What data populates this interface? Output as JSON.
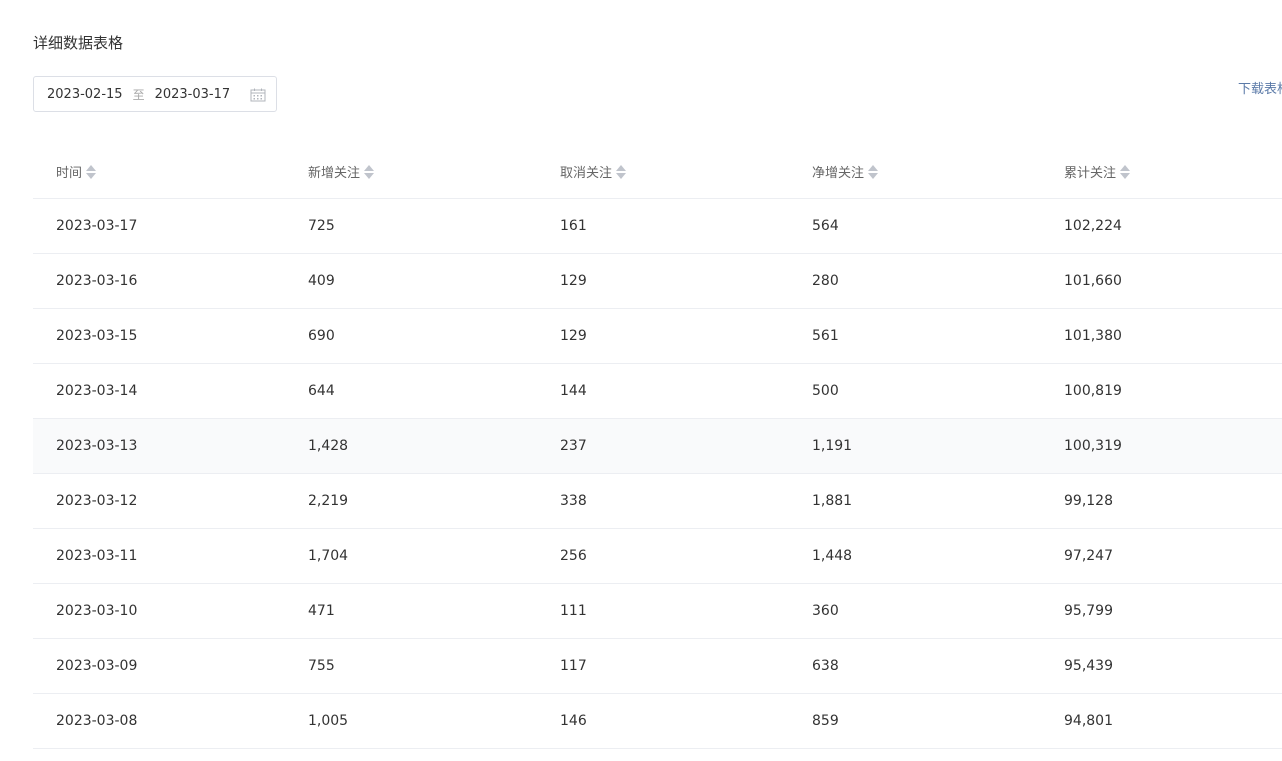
{
  "title": "详细数据表格",
  "date_range": {
    "start": "2023-02-15",
    "separator": "至",
    "end": "2023-03-17"
  },
  "download_label": "下载表格",
  "table": {
    "columns": [
      "时间",
      "新增关注",
      "取消关注",
      "净增关注",
      "累计关注"
    ],
    "rows": [
      [
        "2023-03-17",
        "725",
        "161",
        "564",
        "102,224"
      ],
      [
        "2023-03-16",
        "409",
        "129",
        "280",
        "101,660"
      ],
      [
        "2023-03-15",
        "690",
        "129",
        "561",
        "101,380"
      ],
      [
        "2023-03-14",
        "644",
        "144",
        "500",
        "100,819"
      ],
      [
        "2023-03-13",
        "1,428",
        "237",
        "1,191",
        "100,319"
      ],
      [
        "2023-03-12",
        "2,219",
        "338",
        "1,881",
        "99,128"
      ],
      [
        "2023-03-11",
        "1,704",
        "256",
        "1,448",
        "97,247"
      ],
      [
        "2023-03-10",
        "471",
        "111",
        "360",
        "95,799"
      ],
      [
        "2023-03-09",
        "755",
        "117",
        "638",
        "95,439"
      ],
      [
        "2023-03-08",
        "1,005",
        "146",
        "859",
        "94,801"
      ]
    ],
    "highlighted_row": 4
  }
}
